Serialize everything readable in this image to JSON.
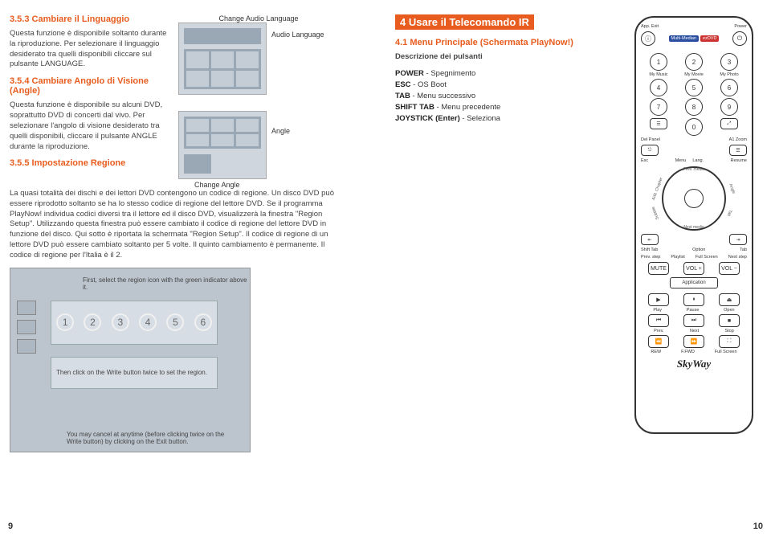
{
  "left": {
    "sec353_title": "3.5.3 Cambiare il Linguaggio",
    "sec353_p1": "Questa funzione è disponibile soltanto durante la riproduzione. Per selezionare il linguaggio desiderato tra quelli disponibili cliccare sul pulsante LANGUAGE.",
    "sec354_title": "3.5.4 Cambiare Angolo di Visione (Angle)",
    "sec354_p1": "Questa funzione è disponibile su alcuni DVD, soprattutto DVD di concerti dal vivo. Per selezionare l'angolo di visione desiderato tra quelli disponibili, cliccare il pulsante ANGLE durante la riproduzione.",
    "sec355_title": "3.5.5 Impostazione Regione",
    "sec355_p1": "La quasi totalità dei dischi e dei lettori DVD contengono un codice di regione. Un disco DVD può essere riprodotto soltanto se ha lo stesso codice di regione del lettore DVD. Se il programma PlayNow! individua codici diversi tra il lettore ed il disco DVD, visualizzerà la finestra \"Region Setup\". Utilizzando questa finestra può essere cambiato il codice di regione del lettore DVD in funzione del disco. Qui sotto è riportata la schermata \"Region Setup\". Il codice di regione di un lettore DVD può essere cambiato soltanto per 5 volte. Il quinto cambiamento è permanente. Il codice di regione per l'Italia è il 2.",
    "audio_label_top": "Change Audio Language",
    "audio_label_right": "Audio Language",
    "angle_label_right": "Angle",
    "angle_label_bottom": "Change Angle",
    "region_hint1": "First, select the region icon with the green indicator above it.",
    "region_hint2": "Then click on the Write button twice to set the region.",
    "region_hint3": "You may cancel at anytime (before clicking twice on the Write button) by clicking on the Exit button.",
    "pagenum": "9"
  },
  "right": {
    "h4": "4 Usare il Telecomando IR",
    "h41": "4.1 Menu Principale (Schermata PlayNow!)",
    "desc_title": "Descrizione dei pulsanti",
    "lines": {
      "power": "POWER - Spegnimento",
      "esc": "ESC - OS Boot",
      "tab": "TAB - Menu successivo",
      "shift": "SHIFT TAB - Menu precedente",
      "joy": "JOYSTICK (Enter) - Seleziona"
    },
    "remote": {
      "top_left": "App. Exit",
      "top_right": "Power",
      "pill_mid": "Multi-Median",
      "pill_right": "ezDVD",
      "num_labels": [
        "My Music",
        "My Movie",
        "My Photo"
      ],
      "del_panel": "Del Panel",
      "a1zoom": "A1 Zoom",
      "esc": "Esc",
      "menu": "Menu",
      "lang": "Lang.",
      "resume": "Resume",
      "add_chap": "Add. Chapter",
      "prev_media": "Prev. media",
      "angle": "Angle",
      "subtitle": "Subtitle",
      "option": "Option",
      "shift_tab": "Shift Tab",
      "tab": "Tab",
      "prev_step": "Prev. step",
      "playlist": "Playlist",
      "next_media": "Next media",
      "fullscreen": "Full Screen",
      "next_step": "Next step",
      "mute": "MUTE",
      "volp": "VOL +",
      "volm": "VOL −",
      "application": "Application",
      "play": "Play",
      "pause": "Pause",
      "open": "Open",
      "prev": "Prev.",
      "next": "Next",
      "stop": "Stop",
      "rew": "REW",
      "ffwd": "F.FWD",
      "fullscr2": "Full Screen",
      "brand": "SkyWay"
    },
    "pagenum": "10"
  }
}
